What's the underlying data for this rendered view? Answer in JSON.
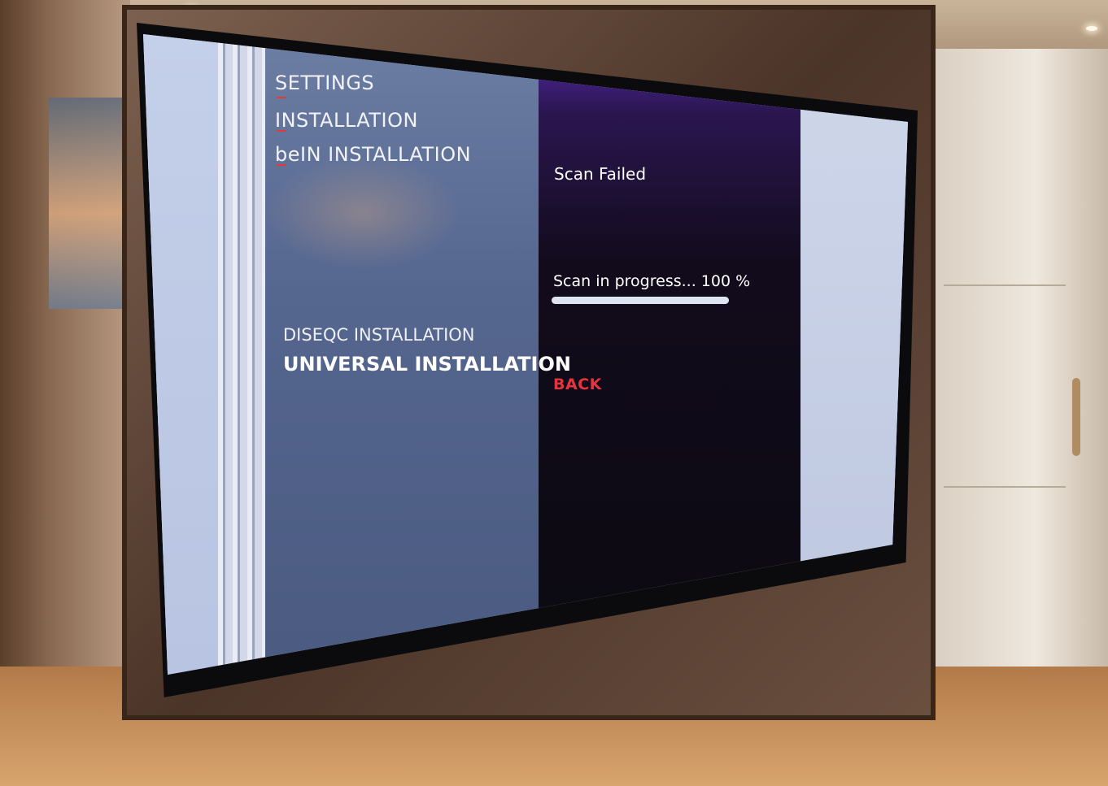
{
  "breadcrumb": {
    "items": [
      "SETTINGS",
      "INSTALLATION",
      "beIN INSTALLATION"
    ]
  },
  "menu": {
    "items": [
      {
        "label": "DISEQC INSTALLATION",
        "selected": false
      },
      {
        "label": "UNIVERSAL INSTALLATION",
        "selected": true
      }
    ]
  },
  "scan": {
    "status": "Scan Failed",
    "progress_label": "Scan in progress... 100 %",
    "progress_percent": 100
  },
  "actions": {
    "back_label": "BACK"
  },
  "colors": {
    "accent_purple": "#5a2bb8",
    "back_red": "#e5343d",
    "marker_red": "#e23a3a",
    "menu_panel": "#55668f"
  }
}
